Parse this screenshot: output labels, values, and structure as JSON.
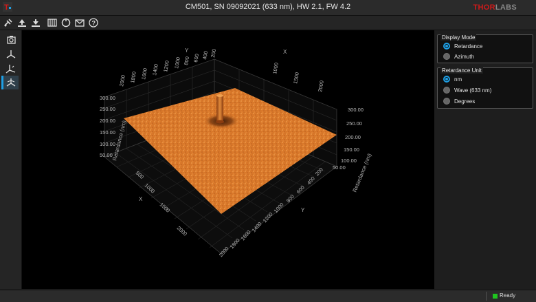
{
  "window": {
    "title": "CM501, SN 09092021 (633 nm), HW 2.1, FW 4.2",
    "logo_primary": "THOR",
    "logo_secondary": "LABS"
  },
  "toolbar": {
    "icons": [
      "connect-icon",
      "upload-icon",
      "download-icon",
      "grid-icon",
      "reset-icon",
      "mail-icon",
      "help-icon"
    ]
  },
  "sidebar": {
    "items": [
      {
        "icon": "camera-icon",
        "active": false
      },
      {
        "icon": "axes-3d-icon",
        "active": false
      },
      {
        "icon": "axes-3d-alt-icon",
        "active": false
      },
      {
        "icon": "surface-3d-icon",
        "active": true
      }
    ]
  },
  "display_mode": {
    "title": "Display Mode",
    "options": [
      "Retardance",
      "Azimuth"
    ],
    "selected": "Retardance"
  },
  "retardance_unit": {
    "title": "Retardance Unit",
    "options": [
      "nm",
      "Wave (633 nm)",
      "Degrees"
    ],
    "selected": "nm"
  },
  "plot": {
    "axis_labels": {
      "x": "X",
      "y": "Y",
      "z_left": "Retardance (nm)",
      "z_right": "Retardance (nm)"
    },
    "z_ticks": [
      "300.00",
      "250.00",
      "200.00",
      "150.00",
      "100.00",
      "50.00"
    ],
    "front_left_ticks": [
      "500",
      "1000",
      "1500",
      "2000"
    ],
    "front_right_ticks": [
      "200",
      "400",
      "600",
      "800",
      "1000",
      "1200",
      "1400",
      "1600",
      "1800",
      "2000"
    ],
    "back_left_ticks": [
      "2000",
      "1800",
      "1600",
      "1400",
      "1200",
      "1000",
      "800",
      "600",
      "400",
      "200"
    ],
    "back_right_ticks": [
      "1000",
      "1500",
      "2000"
    ],
    "surface_color": "#d9782a",
    "peak_color": "#b85a1a"
  },
  "status": {
    "text": "Ready",
    "color": "#1fc41f"
  }
}
